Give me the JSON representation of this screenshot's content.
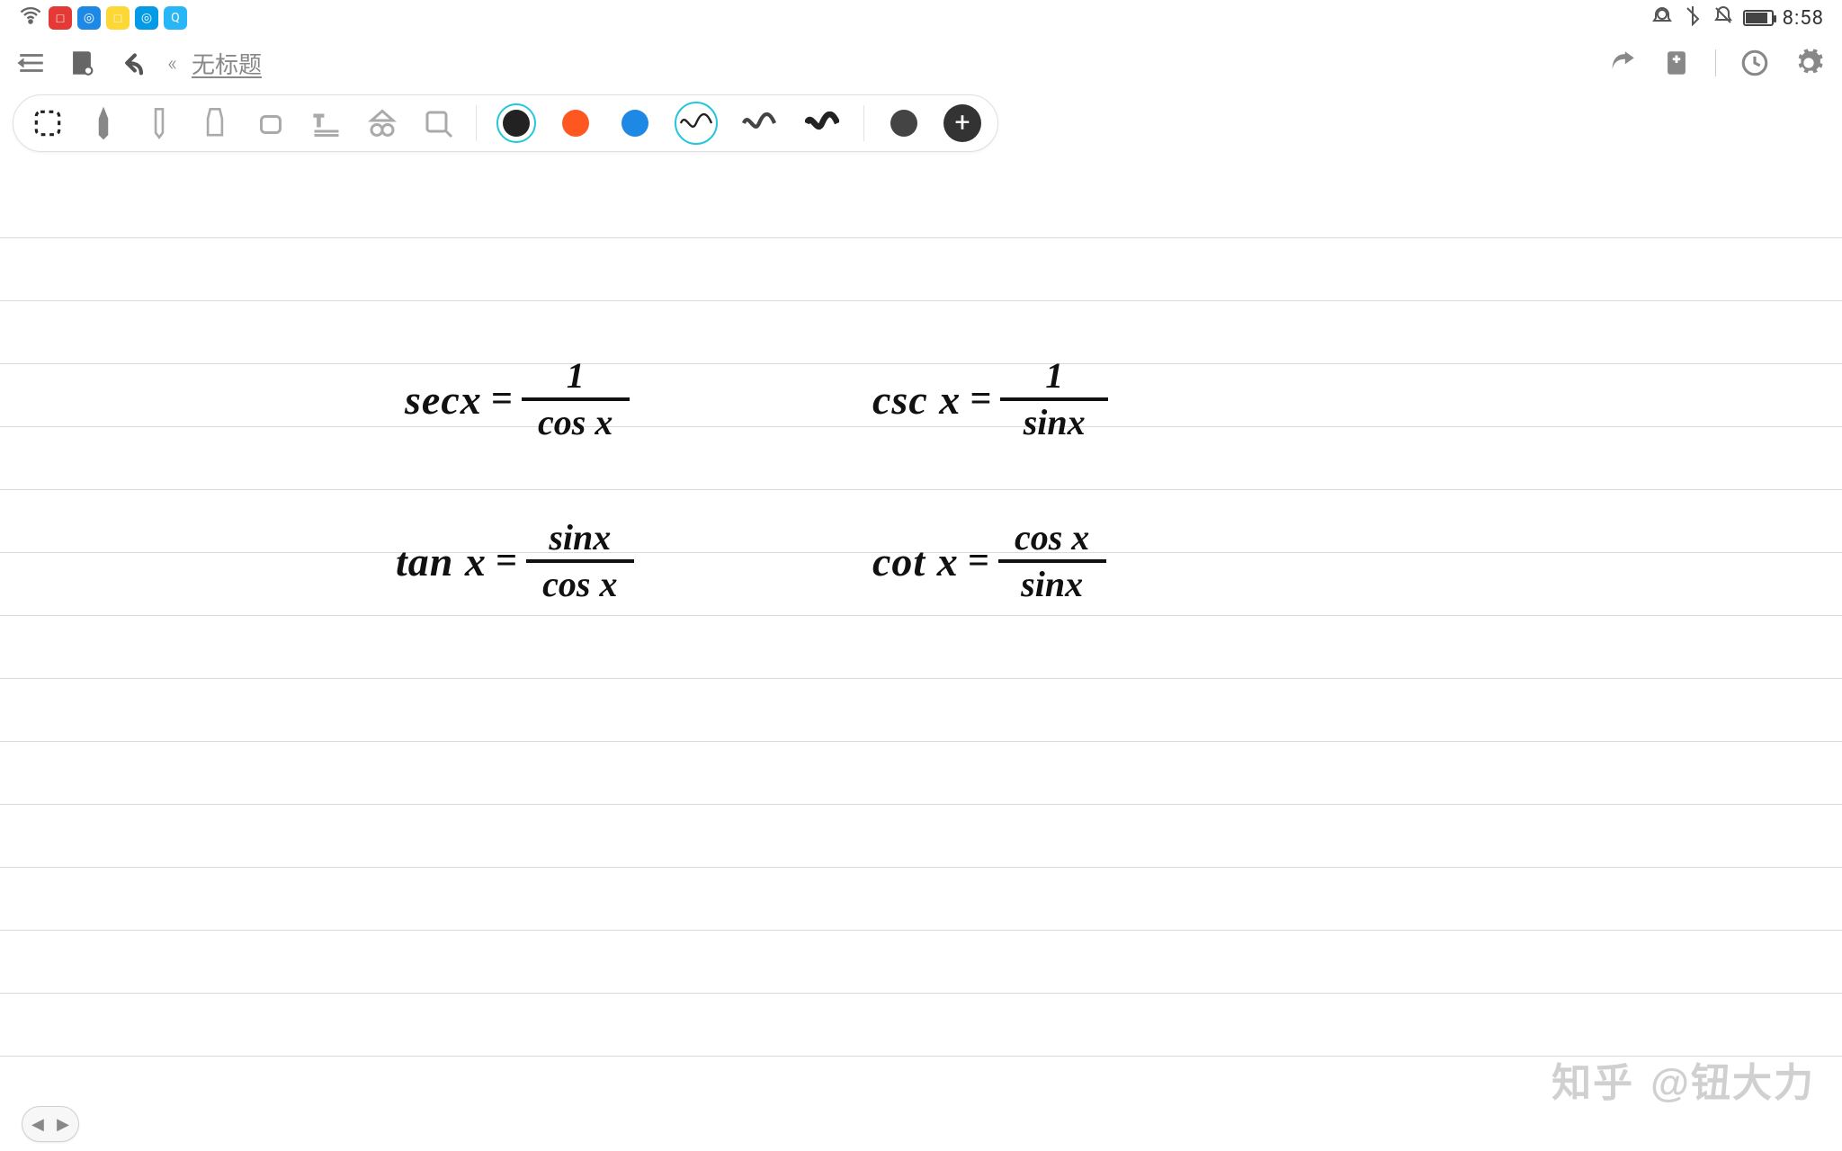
{
  "status": {
    "time": "8:58",
    "app_tiles": [
      "□",
      "◎",
      "□",
      "◎",
      "Q"
    ]
  },
  "header": {
    "doc_title": "无标题"
  },
  "toolbar": {
    "colors": {
      "black": "#222222",
      "orange": "#ff5722",
      "blue": "#1e88e5"
    },
    "extra_dot": "#444444"
  },
  "notes": {
    "eq1": {
      "lhs": "secx",
      "num": "1",
      "den": "cos x"
    },
    "eq2": {
      "lhs": "csc x",
      "num": "1",
      "den": "sinx"
    },
    "eq3": {
      "lhs": "tan x",
      "num": "sinx",
      "den": "cos x"
    },
    "eq4": {
      "lhs": "cot x",
      "num": "cos x",
      "den": "sinx"
    }
  },
  "watermark": {
    "brand": "知乎",
    "at": "@钮大力"
  }
}
